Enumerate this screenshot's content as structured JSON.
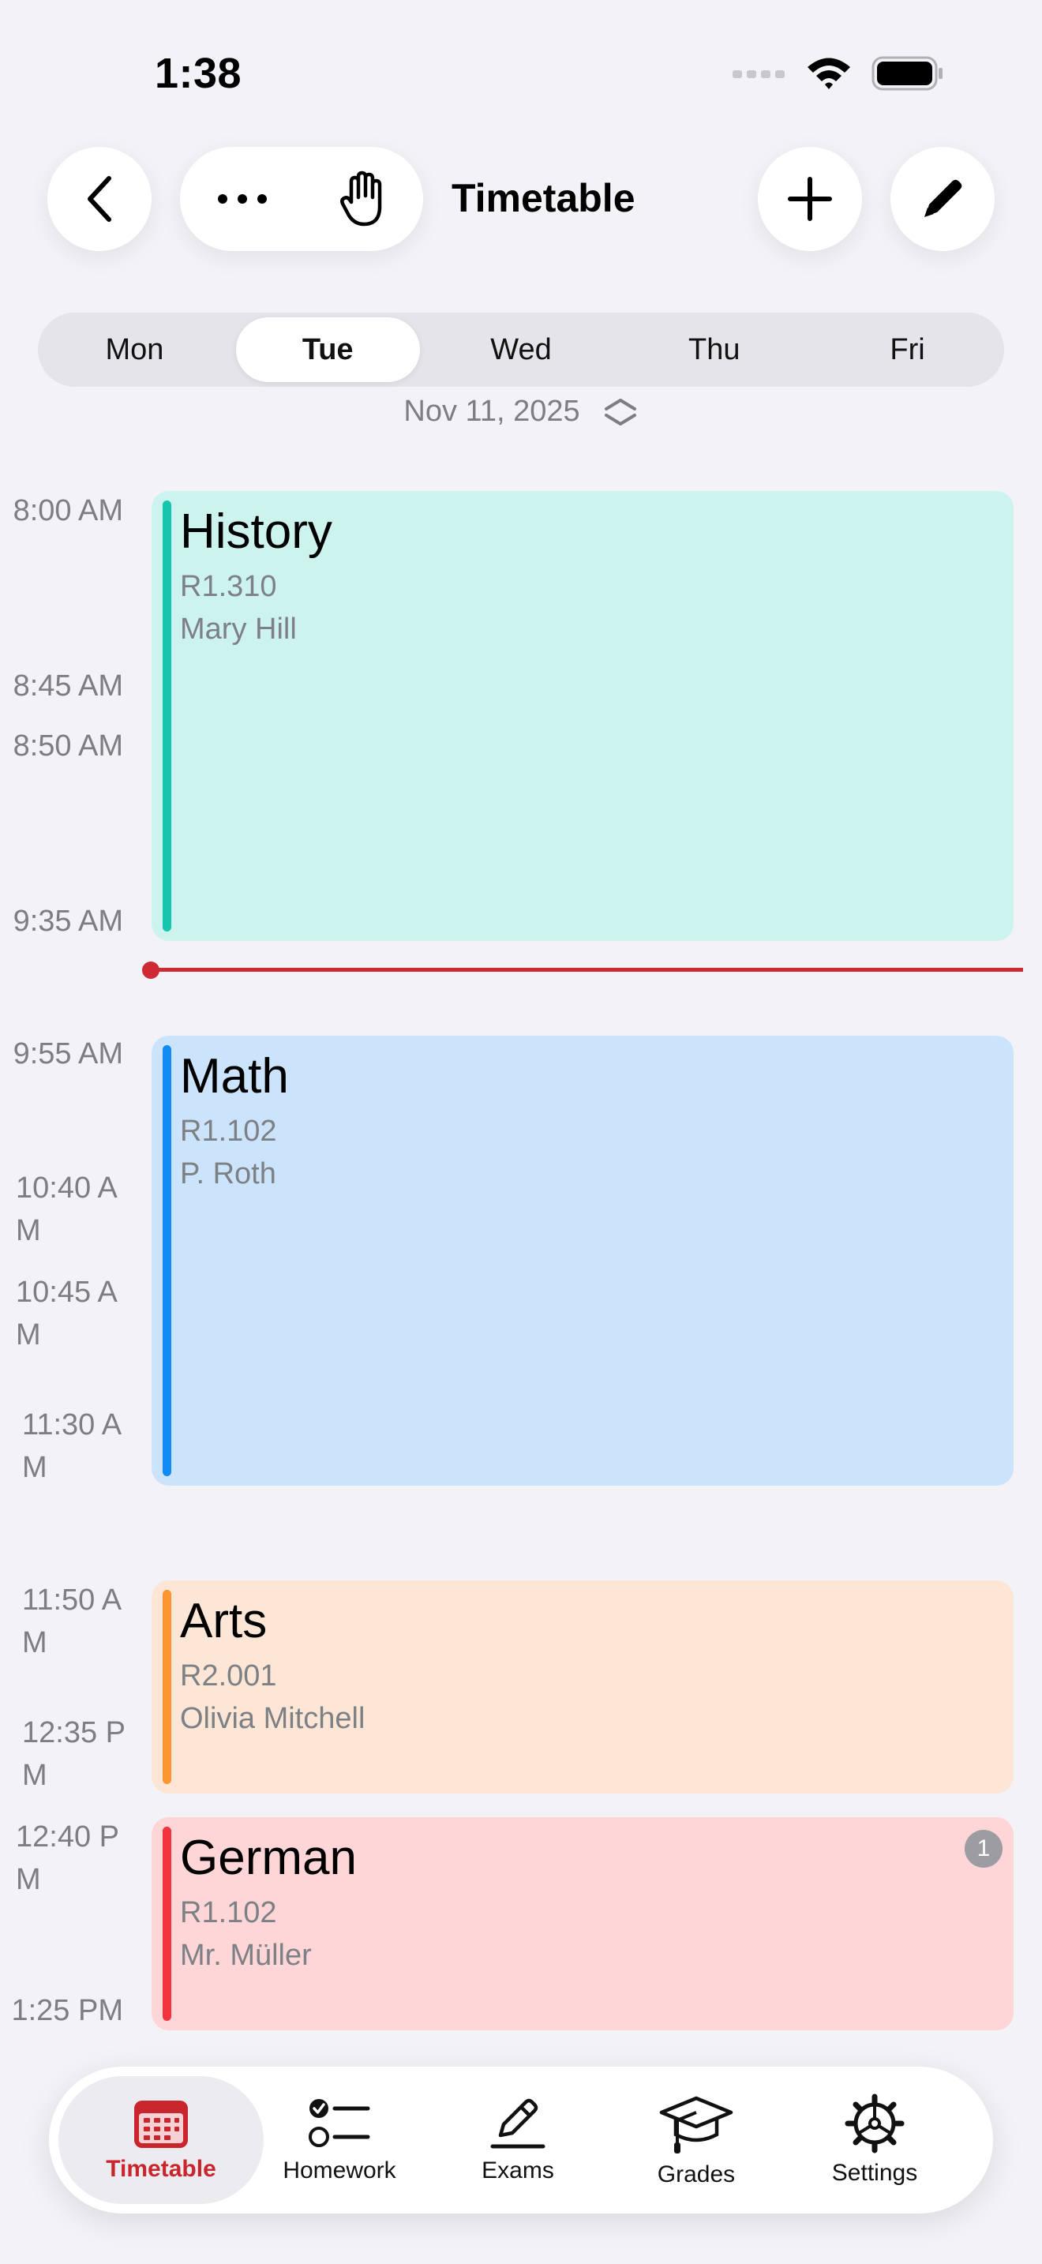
{
  "status_bar": {
    "time": "1:38"
  },
  "nav": {
    "title": "Timetable"
  },
  "days": [
    "Mon",
    "Tue",
    "Wed",
    "Thu",
    "Fri"
  ],
  "selected_day": "Tue",
  "date_label": "Nov 11, 2025",
  "time_labels": [
    "8:00 AM",
    "8:45 AM",
    "8:50 AM",
    "9:35 AM",
    "9:55 AM",
    "10:40 AM",
    "10:45 AM",
    "11:30 AM",
    "11:50 AM",
    "12:35 PM",
    "12:40 PM",
    "1:25 PM"
  ],
  "events": [
    {
      "title": "History",
      "room": "R1.310",
      "teacher": "Mary Hill",
      "bg": "#cdf3ee",
      "accent": "#15c6ad"
    },
    {
      "title": "Math",
      "room": "R1.102",
      "teacher": "P. Roth",
      "bg": "#cce4fb",
      "accent": "#138bf5"
    },
    {
      "title": "Arts",
      "room": "R2.001",
      "teacher": "Olivia Mitchell",
      "bg": "#fde6d6",
      "accent": "#fb9431"
    },
    {
      "title": "German",
      "room": "R1.102",
      "teacher": "Mr. Müller",
      "bg": "#fed6d8",
      "accent": "#f3343f",
      "badge": "1"
    }
  ],
  "tabs": [
    {
      "label": "Timetable",
      "icon": "calendar-icon"
    },
    {
      "label": "Homework",
      "icon": "checklist-icon"
    },
    {
      "label": "Exams",
      "icon": "pencil-line-icon"
    },
    {
      "label": "Grades",
      "icon": "graduation-cap-icon"
    },
    {
      "label": "Settings",
      "icon": "gear-icon"
    }
  ],
  "colors": {
    "accent": "#c9252d",
    "now_line": "#cf2a33"
  }
}
